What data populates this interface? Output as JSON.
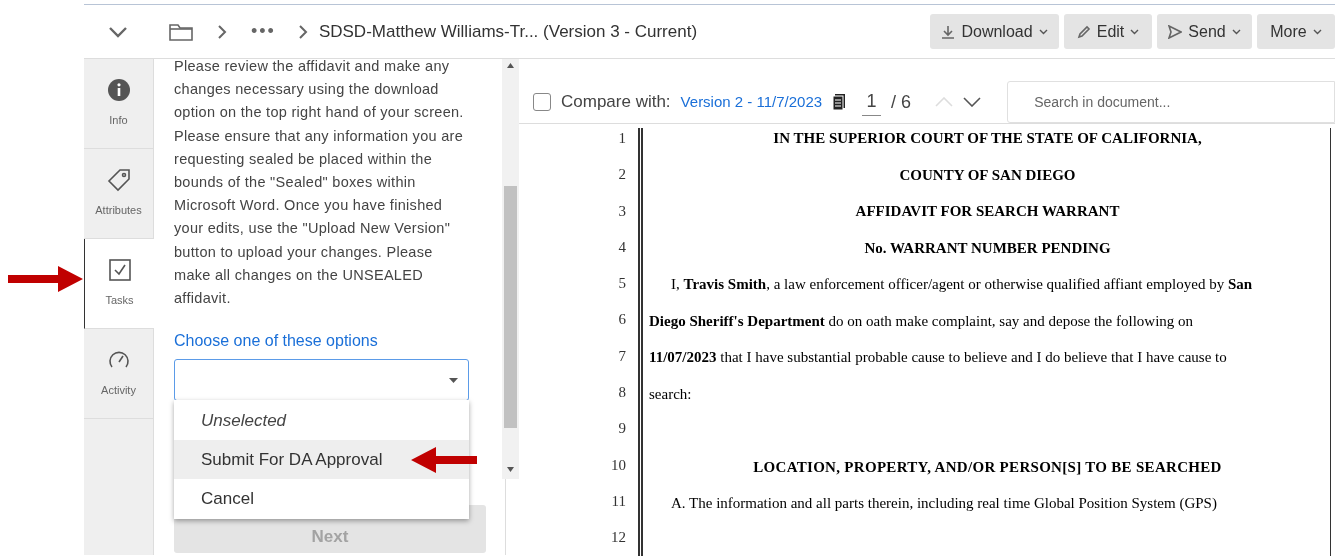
{
  "header": {
    "breadcrumb_more": "•••",
    "title": "SDSD-Matthew Williams-Tr... (Version 3 - Current)",
    "actions": [
      {
        "label": "Download",
        "kind": "download"
      },
      {
        "label": "Edit",
        "kind": "edit"
      },
      {
        "label": "Send",
        "kind": "send"
      },
      {
        "label": "More",
        "kind": "more"
      }
    ]
  },
  "side_tabs": [
    {
      "label": "Info",
      "kind": "info",
      "selected": false
    },
    {
      "label": "Attributes",
      "kind": "attributes",
      "selected": false
    },
    {
      "label": "Tasks",
      "kind": "tasks",
      "selected": true
    },
    {
      "label": "Activity",
      "kind": "activity",
      "selected": false
    }
  ],
  "task_panel": {
    "instructions": "Please review the affidavit and make any changes necessary using the download option on the top right hand of your screen. Please ensure that any information you are requesting sealed be placed within the bounds of the \"Sealed\" boxes within Microsoft Word. Once you have finished your edits, use the \"Upload New Version\" button to upload your changes. Please make all changes on the UNSEALED affidavit.",
    "options_label": "Choose one of these options",
    "options": [
      {
        "label": "Unselected",
        "kind": "placeholder",
        "selected": false
      },
      {
        "label": "Submit For DA Approval",
        "kind": "option",
        "selected": true
      },
      {
        "label": "Cancel",
        "kind": "option",
        "selected": false
      }
    ],
    "next_button": {
      "label": "Next",
      "disabled": true
    }
  },
  "viewer_toolbar": {
    "compare_checked": false,
    "compare_label": "Compare with:",
    "compare_version": "Version 2 - 11/7/2023",
    "page": "1",
    "page_total": "/ 6",
    "prev_disabled": true,
    "next_disabled": false,
    "search": {
      "placeholder": "Search in document..."
    }
  },
  "document": {
    "line_numbers": [
      "1",
      "2",
      "3",
      "4",
      "5",
      "6",
      "7",
      "8",
      "9",
      "10",
      "11",
      "12"
    ],
    "lines": [
      {
        "kind": "heading",
        "text": "IN THE SUPERIOR COURT OF THE STATE OF CALIFORNIA,"
      },
      {
        "kind": "heading",
        "text": "COUNTY OF SAN DIEGO"
      },
      {
        "kind": "heading",
        "text": "AFFIDAVIT  FOR SEARCH WARRANT"
      },
      {
        "kind": "heading",
        "text": "No. WARRANT NUMBER PENDING"
      },
      {
        "kind": "body_indent",
        "text": "I, **Travis Smith**, a law enforcement officer/agent or otherwise qualified affiant employed by **San**"
      },
      {
        "kind": "body",
        "text": "**Diego Sheriff's Department** do on oath make complaint, say and depose the following on"
      },
      {
        "kind": "body",
        "text": "**11/07/2023** that I have substantial probable cause to believe and I do believe that I have cause to"
      },
      {
        "kind": "body",
        "text": "search:"
      },
      {
        "kind": "section_heading",
        "text": "LOCATION, PROPERTY, AND/OR PERSON[S] TO BE SEARCHED"
      },
      {
        "kind": "body_indent",
        "text": "A. The information and all parts therein, including real time Global Position System (GPS)"
      }
    ]
  }
}
